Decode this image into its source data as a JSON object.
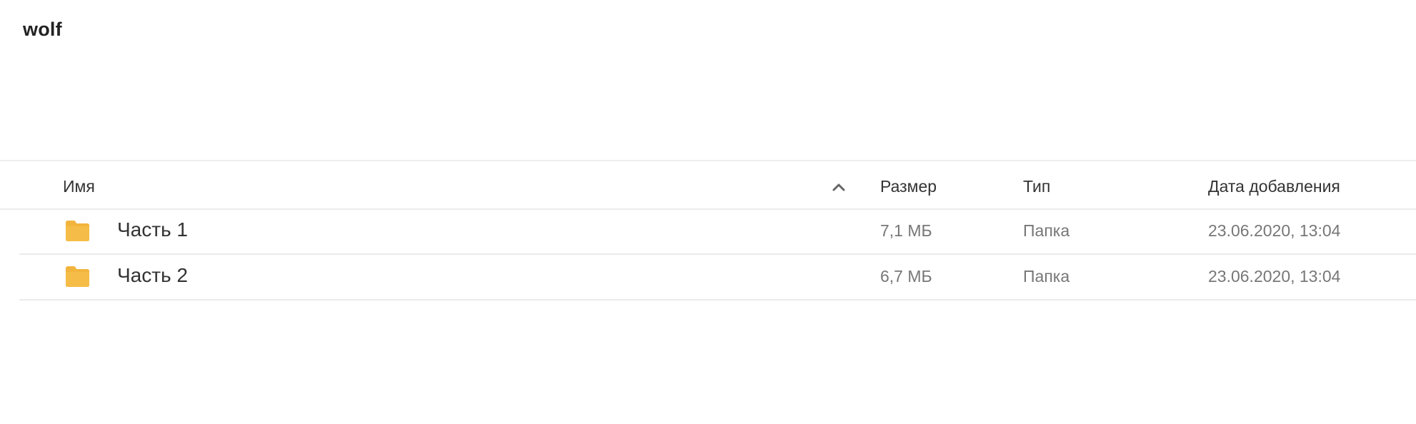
{
  "folder_title": "wolf",
  "table": {
    "columns": {
      "name": "Имя",
      "size": "Размер",
      "type": "Тип",
      "date": "Дата добавления"
    },
    "sort_icon": "chevron-up-icon",
    "rows": [
      {
        "name": "Часть 1",
        "size": "7,1 МБ",
        "type": "Папка",
        "date": "23.06.2020, 13:04",
        "icon": "folder-icon"
      },
      {
        "name": "Часть 2",
        "size": "6,7 МБ",
        "type": "Папка",
        "date": "23.06.2020, 13:04",
        "icon": "folder-icon"
      }
    ]
  },
  "colors": {
    "folder": "#f2b43c",
    "text": "#333333",
    "muted_text": "#777777",
    "divider": "#ebebeb"
  }
}
